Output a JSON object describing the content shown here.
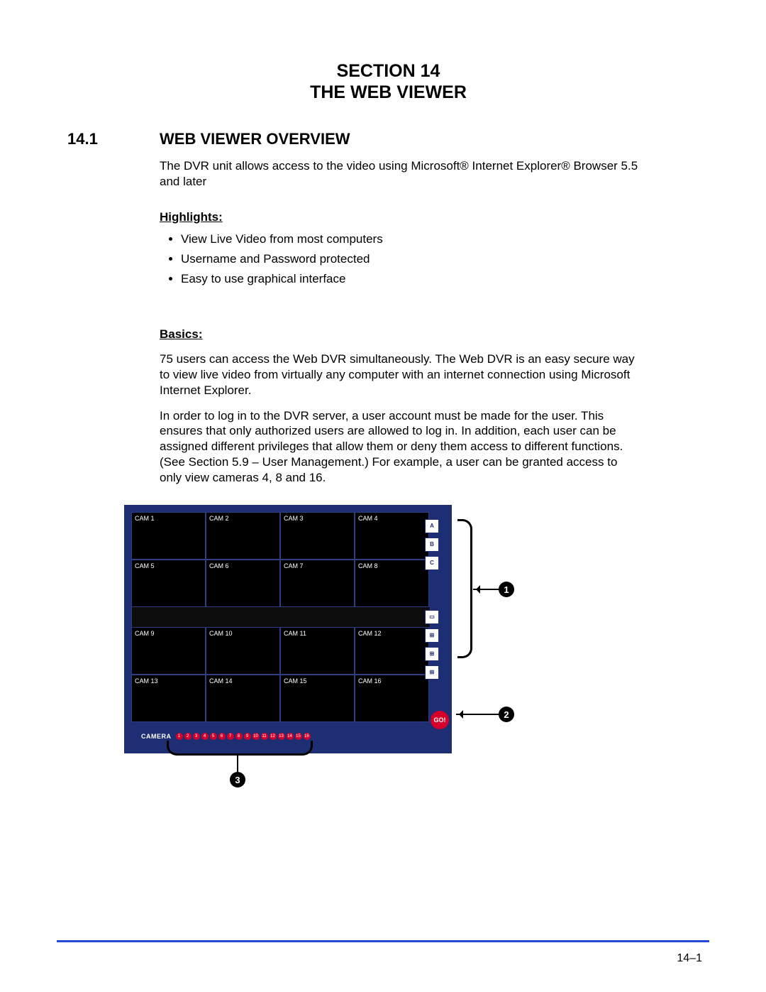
{
  "section_line1": "SECTION 14",
  "section_line2": "THE WEB VIEWER",
  "h1_num": "14.1",
  "h1_title": "WEB VIEWER OVERVIEW",
  "intro": "The DVR unit allows access to the video using Microsoft® Internet Explorer® Browser 5.5 and later",
  "highlights_head": "Highlights:",
  "highlights": [
    "View Live Video from most computers",
    "Username and Password protected",
    "Easy to use graphical interface"
  ],
  "basics_head": "Basics:",
  "basics_p1": "75 users can access the Web DVR simultaneously. The Web DVR is an easy secure way to view live video from virtually any computer with an internet connection using Microsoft Internet Explorer.",
  "basics_p2": "In order to log in to the DVR server, a user account must be made for the user. This ensures that only authorized users are allowed to log in. In addition, each user can be assigned different privileges that allow them or deny them access to different functions. (See Section 5.9 – User Management.)  For example, a user can be granted access to only view cameras 4, 8 and 16.",
  "figure": {
    "cams": [
      "CAM 1",
      "CAM 2",
      "CAM 3",
      "CAM 4",
      "CAM 5",
      "CAM 6",
      "CAM 7",
      "CAM 8",
      "CAM 9",
      "CAM 10",
      "CAM 11",
      "CAM 12",
      "CAM 13",
      "CAM 14",
      "CAM 15",
      "CAM 16"
    ],
    "layout_btns": [
      "A",
      "B",
      "C",
      "▭",
      "⊞",
      "⊞",
      "⊞"
    ],
    "go": "GO!",
    "camera_label": "CAMERA",
    "cam_dots": [
      "1",
      "2",
      "3",
      "4",
      "5",
      "6",
      "7",
      "8",
      "9",
      "10",
      "11",
      "12",
      "13",
      "14",
      "15",
      "16"
    ]
  },
  "callouts": {
    "one": "1",
    "two": "2",
    "three": "3"
  },
  "page_num": "14–1"
}
